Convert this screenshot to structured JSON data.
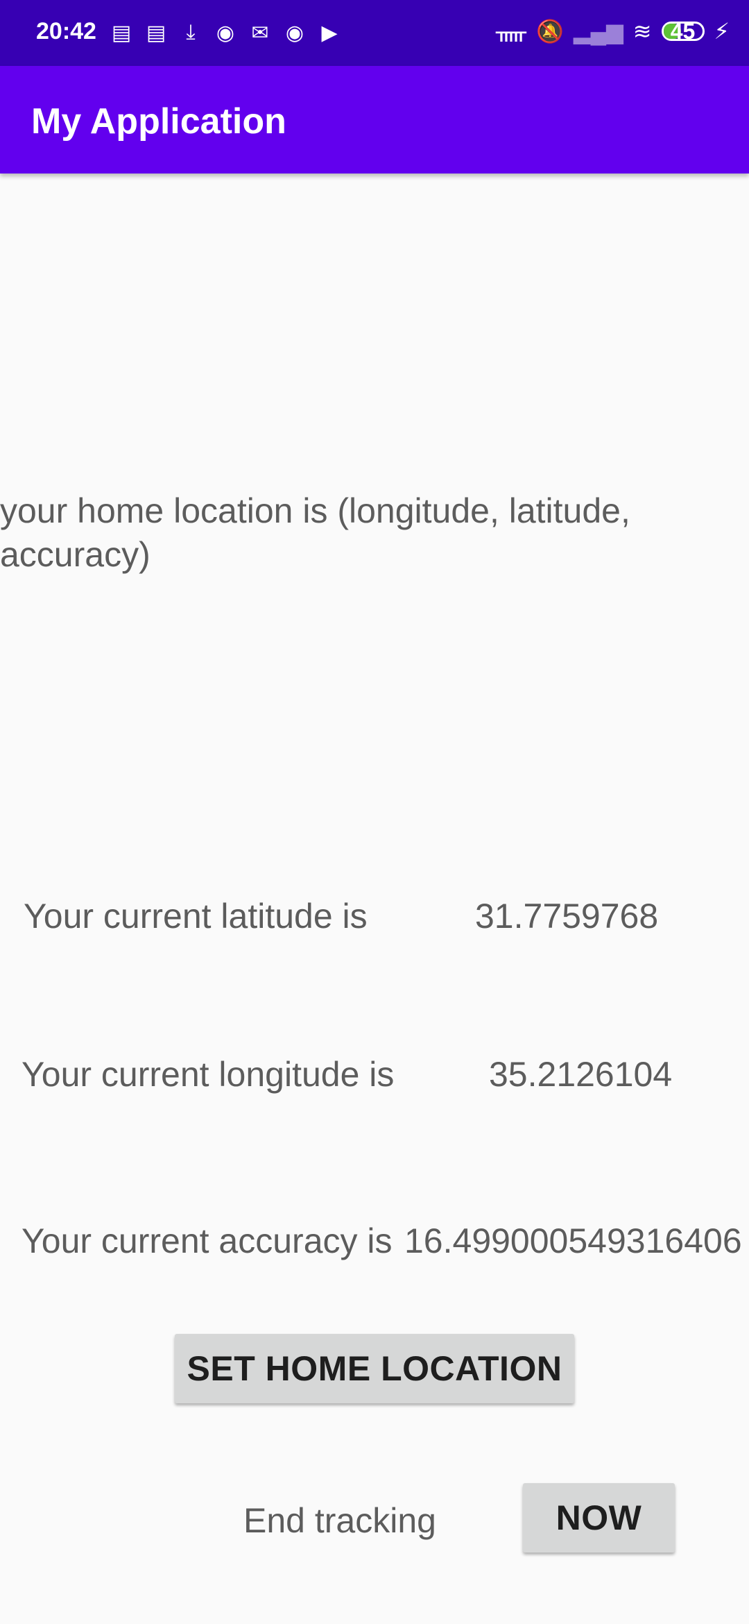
{
  "status_bar": {
    "time": "20:42",
    "notification_icons": [
      "message-icon",
      "message-icon",
      "download-icon",
      "at-icon",
      "mail-icon",
      "at-icon",
      "play-icon"
    ],
    "battery_level": "45",
    "colors": {
      "background": "#3700b3"
    }
  },
  "app_bar": {
    "title": "My Application",
    "colors": {
      "background": "#6200ee"
    }
  },
  "main": {
    "home_location_label": "your home location is (longitude, latitude, accuracy)",
    "latitude_label": "Your current latitude is",
    "latitude_value": "31.7759768",
    "longitude_label": "Your current longitude is",
    "longitude_value": "35.2126104",
    "accuracy_label": "Your current accuracy is",
    "accuracy_value": "16.499000549316406",
    "set_home_button": "SET HOME LOCATION",
    "end_tracking_label": "End tracking",
    "now_button": "NOW"
  }
}
